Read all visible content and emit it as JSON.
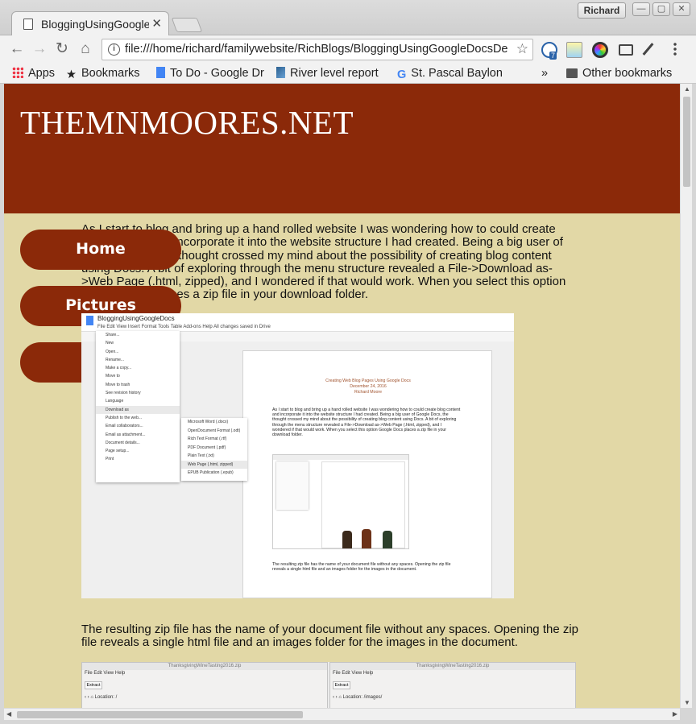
{
  "window": {
    "tab_title": "BloggingUsingGoogleDocsDe",
    "user_name": "Richard"
  },
  "toolbar": {
    "url": "file:///home/richard/familywebsite/RichBlogs/BloggingUsingGoogleDocsDe",
    "extension_badge": "7"
  },
  "bookmarks": {
    "items": [
      "Apps",
      "Bookmarks",
      "To Do - Google Dr",
      "River level report",
      "St. Pascal Baylon"
    ],
    "overflow": "»",
    "other": "Other bookmarks"
  },
  "site": {
    "title": "THEMNMOORES.NET",
    "nav": [
      "Home",
      "Pictures"
    ],
    "para1": "As I start to blog and bring up a hand rolled website I was wondering how to could create blog content and incorporate it into the website structure I had created. Being a big user of Google Docs, the thought crossed my mind about the possibility of creating blog content using Docs. A bit of exploring through the menu structure revealed a File->Download as->Web Page (.html, zipped), and I wondered if that would work. When you select this option Google Docs places a zip file in your download folder.",
    "para2": "The resulting zip file has the name of your document file without any spaces. Opening the zip file reveals a single html file and an images folder for the images in the document."
  },
  "embedded_doc": {
    "doc_title": "BloggingUsingGoogleDocs",
    "menu": "File   Edit   View   Insert   Format   Tools   Table   Add-ons   Help     All changes saved in Drive",
    "file_menu": [
      "Share...",
      "New",
      "Open...",
      "Rename...",
      "Make a copy...",
      "Move to",
      "Move to trash",
      "See revision history",
      "Language",
      "Download as",
      "Publish to the web...",
      "Email collaborators...",
      "Email as attachment...",
      "Document details...",
      "Page setup...",
      "Print"
    ],
    "download_menu": [
      "Microsoft Word (.docx)",
      "OpenDocument Format (.odt)",
      "Rich Text Format (.rtf)",
      "PDF Document (.pdf)",
      "Plain Text (.txt)",
      "Web Page (.html, zipped)",
      "EPUB Publication (.epub)"
    ],
    "page_heading": "Creating Web Blog Pages Using Google Docs",
    "page_date": "December 24, 2016",
    "page_author": "Richard Moore",
    "page_para": "As I start to blog and bring up a hand rolled website I was wondering how to could create blog content and incorporate it into the website structure I had created. Being a big user of Google Docs, the thought crossed my mind about the possibility of creating blog content using Docs. A bit of exploring through the menu structure revealed a File->Download as->Web Page (.html, zipped), and I wondered if that would work. When you select this option Google Docs places a zip file in your download folder.",
    "page_para2": "The resulting zip file has the name of your document file without any spaces. Opening the zip file reveals a single html file and an images folder for the images in the document."
  },
  "embedded_archive": {
    "left_title": "ThanksgivingWineTasting2016.zip",
    "right_title": "ThanksgivingWineTasting2016.zip",
    "menu": "File   Edit   View   Help",
    "extract": "Extract",
    "location_label": "Location:",
    "left_path": "/",
    "right_path": "/images/"
  }
}
